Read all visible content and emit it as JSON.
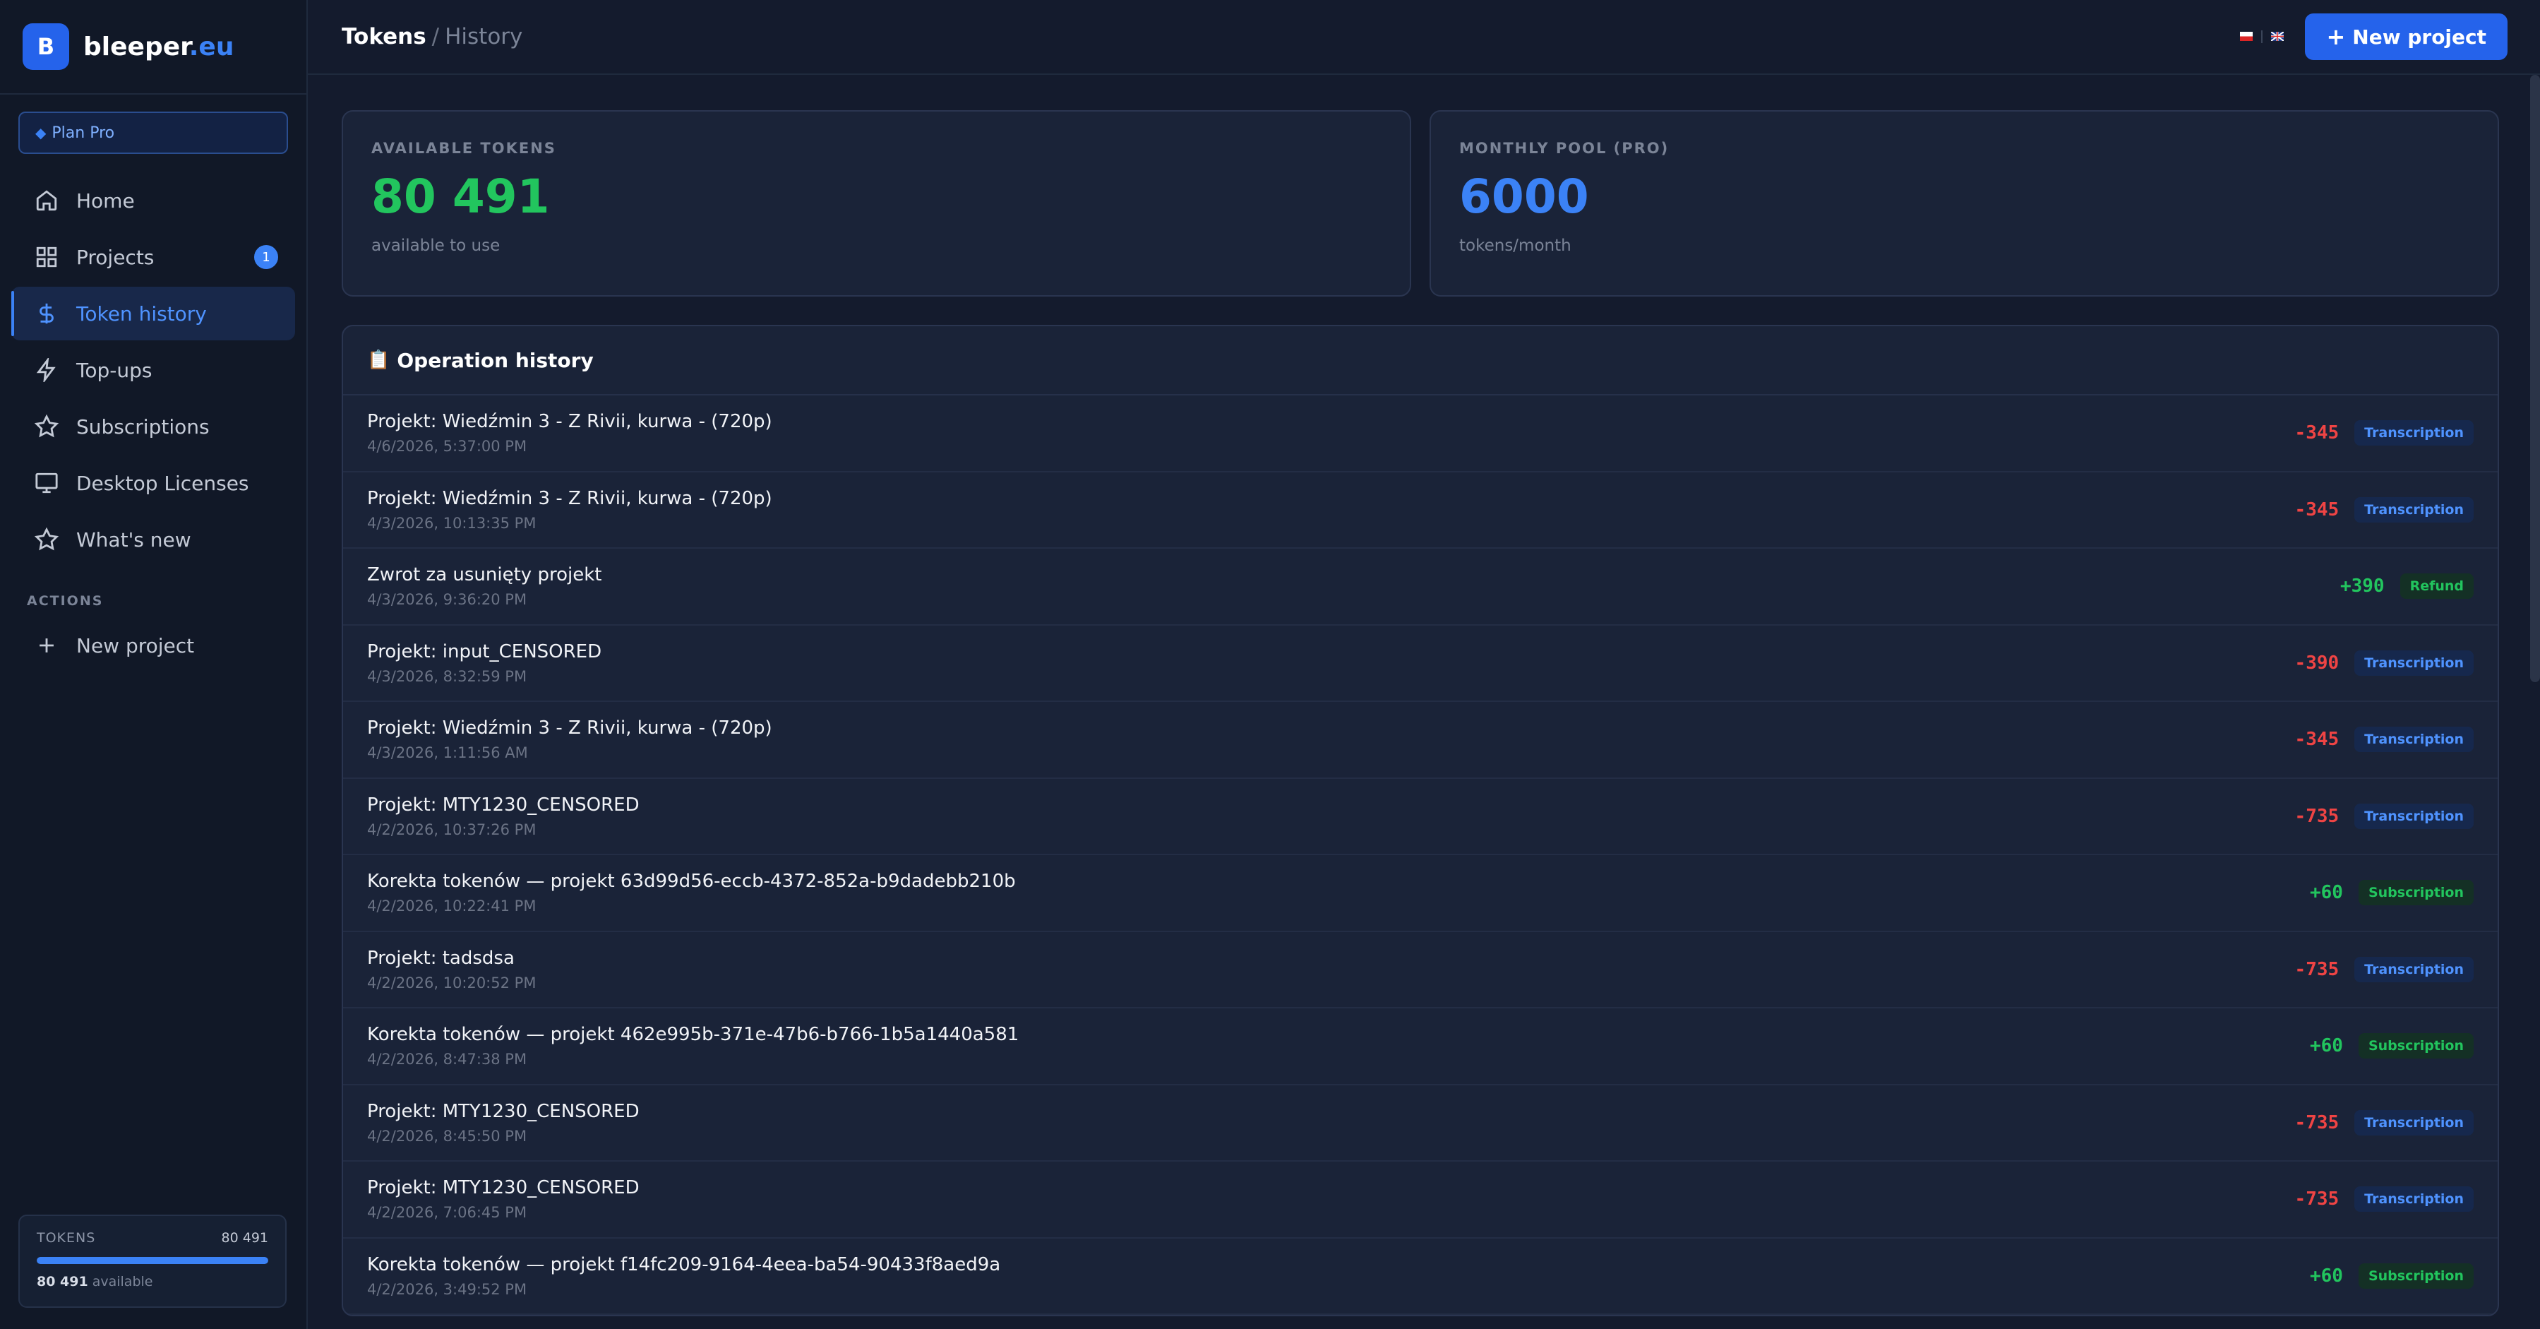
{
  "brand": {
    "logo_letter": "B",
    "name": "bleeper",
    "tld": ".eu"
  },
  "plan": {
    "icon": "diamond-icon",
    "label": "Plan Pro"
  },
  "nav": [
    {
      "label": "Home",
      "icon": "home-icon",
      "active": false
    },
    {
      "label": "Projects",
      "icon": "grid-icon",
      "active": false,
      "badge": "1"
    },
    {
      "label": "Token history",
      "icon": "dollar-icon",
      "active": true
    },
    {
      "label": "Top-ups",
      "icon": "bolt-icon",
      "active": false
    },
    {
      "label": "Subscriptions",
      "icon": "star-icon",
      "active": false
    },
    {
      "label": "Desktop Licenses",
      "icon": "monitor-icon",
      "active": false
    },
    {
      "label": "What's new",
      "icon": "star-icon",
      "active": false
    }
  ],
  "actions": {
    "section_label": "ACTIONS",
    "new_project": "New project"
  },
  "tokens_widget": {
    "label": "TOKENS",
    "value": "80 491",
    "available_value": "80 491",
    "available_text": "available",
    "fill_percent": 100
  },
  "header": {
    "crumb_current": "Tokens",
    "crumb_separator": "/",
    "crumb_sub": "History",
    "new_project_button": "New project"
  },
  "flags": {
    "pl": "PL",
    "en": "EN"
  },
  "stats": {
    "available": {
      "label": "AVAILABLE TOKENS",
      "value": "80 491",
      "sub": "available to use"
    },
    "monthly": {
      "label": "MONTHLY POOL (PRO)",
      "value": "6000",
      "sub": "tokens/month"
    }
  },
  "history": {
    "title": "Operation history",
    "rows": [
      {
        "title": "Projekt: Wiedźmin 3 - Z Rivii, kurwa - (720p)",
        "date": "4/6/2026, 5:37:00 PM",
        "amount": "-345",
        "tag": "Transcription"
      },
      {
        "title": "Projekt: Wiedźmin 3 - Z Rivii, kurwa - (720p)",
        "date": "4/3/2026, 10:13:35 PM",
        "amount": "-345",
        "tag": "Transcription"
      },
      {
        "title": "Zwrot za usunięty projekt",
        "date": "4/3/2026, 9:36:20 PM",
        "amount": "+390",
        "tag": "Refund"
      },
      {
        "title": "Projekt: input_CENSORED",
        "date": "4/3/2026, 8:32:59 PM",
        "amount": "-390",
        "tag": "Transcription"
      },
      {
        "title": "Projekt: Wiedźmin 3 - Z Rivii, kurwa - (720p)",
        "date": "4/3/2026, 1:11:56 AM",
        "amount": "-345",
        "tag": "Transcription"
      },
      {
        "title": "Projekt: MTY1230_CENSORED",
        "date": "4/2/2026, 10:37:26 PM",
        "amount": "-735",
        "tag": "Transcription"
      },
      {
        "title": "Korekta tokenów — projekt 63d99d56-eccb-4372-852a-b9dadebb210b",
        "date": "4/2/2026, 10:22:41 PM",
        "amount": "+60",
        "tag": "Subscription"
      },
      {
        "title": "Projekt: tadsdsa",
        "date": "4/2/2026, 10:20:52 PM",
        "amount": "-735",
        "tag": "Transcription"
      },
      {
        "title": "Korekta tokenów — projekt 462e995b-371e-47b6-b766-1b5a1440a581",
        "date": "4/2/2026, 8:47:38 PM",
        "amount": "+60",
        "tag": "Subscription"
      },
      {
        "title": "Projekt: MTY1230_CENSORED",
        "date": "4/2/2026, 8:45:50 PM",
        "amount": "-735",
        "tag": "Transcription"
      },
      {
        "title": "Projekt: MTY1230_CENSORED",
        "date": "4/2/2026, 7:06:45 PM",
        "amount": "-735",
        "tag": "Transcription"
      },
      {
        "title": "Korekta tokenów — projekt f14fc209-9164-4eea-ba54-90433f8aed9a",
        "date": "4/2/2026, 3:49:52 PM",
        "amount": "+60",
        "tag": "Subscription"
      }
    ]
  },
  "colors": {
    "accent": "#3b82f6",
    "positive": "#22c55e",
    "negative": "#ef4444",
    "background": "#141b2d"
  }
}
